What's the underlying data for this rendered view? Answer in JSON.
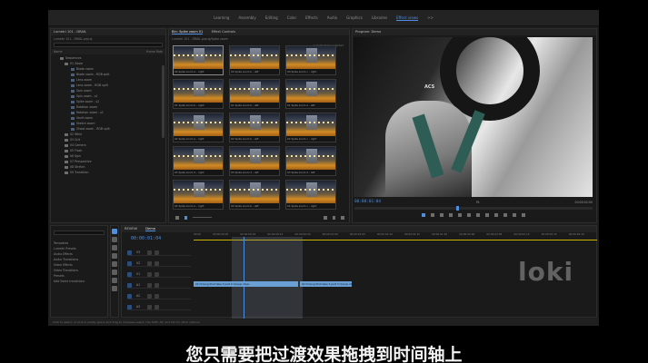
{
  "workspaces": [
    "Learning",
    "Assembly",
    "Editing",
    "Color",
    "Effects",
    "Audio",
    "Graphics",
    "Libraries",
    "Effect views",
    ">>"
  ],
  "project_panel": {
    "title": "Lumetri 101 - DRAIL",
    "path": "Lumetri 101 - DRAIL.prproj",
    "items_header": "Name",
    "frame_header": "Frame Rate",
    "tree": [
      "Sequences",
      "01 Zoom",
      "Blade zoom",
      "Blade zoom - RGB split",
      "Lens zoom",
      "Lens zoom - RGB split",
      "Spin zoom",
      "Spin zoom - s1",
      "Spike zoom - s2",
      "Rotation zoom",
      "Rotation zoom - s1",
      "Vault zoom",
      "Sketch zoom",
      "Ghost zoom - RGB split",
      "02 Whirl",
      "03 Grit",
      "04 Camera",
      "05 Flash",
      "06 Spin",
      "07 Perspective",
      "08 Stretch",
      "09 Transition"
    ]
  },
  "bin_panel": {
    "tabs": [
      "Bin: Spike zoom 01",
      "Effect Controls"
    ],
    "path": "Lumetri 101 - DRAIL.prproj/Spike zoom",
    "count_label": "1 of 15 items selected",
    "thumbs": [
      "00 Spike zoom a - right",
      "00 Spike zoom b - left",
      "00 Spike zoom c - right",
      "01 Spike zoom b - right",
      "01 Spike zoom b - left",
      "01 Spike zoom e - left",
      "02 Spike zoom a - right",
      "02 Spike zoom b - left",
      "02 Spike zoom c - right",
      "03 Spike zoom 2 - right",
      "03 Spike zoom 2 - left",
      "03 Spike zoom 2 - left",
      "04 Spike zoom a - right",
      "04 Spike zoom b - left",
      "04 Spike zoom c - right"
    ]
  },
  "program_monitor": {
    "title": "Program: Demo",
    "timecode": "00:00:01:04",
    "fit_label": "Fit",
    "end_timecode": "00:00:02:00",
    "overlay_text": "ACS"
  },
  "effects_panel": {
    "items": [
      "Templates",
      "Lumetri Presets",
      "Audio Effects",
      "Audio Transitions",
      "Video Effects",
      "Video Transitions",
      "Presets",
      "Add Some transitions"
    ]
  },
  "timeline": {
    "tabs": [
      "REVIEW",
      "Demo"
    ],
    "timecode": "00:00:01:04",
    "ruler": [
      "00:00",
      "00:00:00:05",
      "00:00:00:10",
      "00:00:00:15",
      "00:00:00:20",
      "00:00:01:00",
      "00:00:01:05",
      "00:00:01:10",
      "00:00:01:15",
      "00:00:01:20",
      "00:00:02:00",
      "00:00:02:05",
      "00:00:02:10",
      "00:00:02:15",
      "00:00:02:20"
    ],
    "tracks": [
      "V3",
      "V2",
      "V1",
      "A1",
      "A2",
      "A3"
    ],
    "clip_left": "02 Driving Shot take 3 part 2 (Group clips)",
    "clip_right": "02 Driving Shot take 3 part 3 (Group clips)"
  },
  "status_text": "Click to select, or click in empty space and drag to marquee select. Use Shift, Alt, and Ctrl for other options.",
  "watermark": "loki",
  "subtitle": "您只需要把过渡效果拖拽到时间轴上"
}
